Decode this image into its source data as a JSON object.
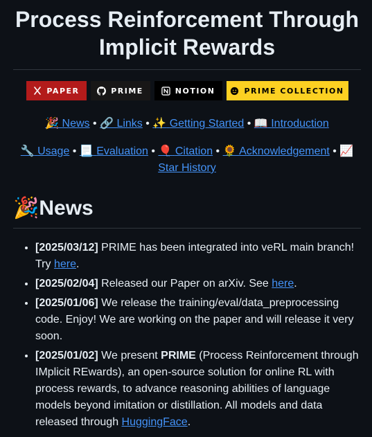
{
  "title": "Process Reinforcement Through Implicit Rewards",
  "badges": {
    "paper": {
      "label": "PAPER",
      "icon": "arxiv-icon"
    },
    "prime": {
      "label": "PRIME",
      "icon": "github-icon"
    },
    "notion": {
      "label": "NOTION",
      "icon": "notion-icon"
    },
    "collection": {
      "label": "PRIME COLLECTION",
      "icon": "huggingface-icon"
    }
  },
  "nav": {
    "news": {
      "emoji": "🎉",
      "label": "News"
    },
    "links": {
      "emoji": "🔗",
      "label": "Links"
    },
    "getting_started": {
      "emoji": "✨",
      "label": "Getting Started"
    },
    "introduction": {
      "emoji": "📖",
      "label": "Introduction"
    },
    "usage": {
      "emoji": "🔧",
      "label": "Usage"
    },
    "evaluation": {
      "emoji": "📃",
      "label": "Evaluation"
    },
    "citation": {
      "emoji": "🎈",
      "label": "Citation"
    },
    "acknowledgement": {
      "emoji": "🌻",
      "label": "Acknowledgement"
    },
    "star_history": {
      "emoji": "📈",
      "label": "Star History"
    },
    "separator": "•"
  },
  "news_section": {
    "emoji": "🎉",
    "heading": "News",
    "items": [
      {
        "date": "[2025/03/12]",
        "text_before": " PRIME has been integrated into veRL main branch! Try ",
        "link": "here",
        "text_after": "."
      },
      {
        "date": "[2025/02/04]",
        "text_before": " Released our Paper on arXiv. See ",
        "link": "here",
        "text_after": "."
      },
      {
        "date": "[2025/01/06]",
        "text": " We release the training/eval/data_preprocessing code. Enjoy! We are working on the paper and will release it very soon."
      },
      {
        "date": "[2025/01/02]",
        "text_before": " We present ",
        "bold": "PRIME",
        "text_middle": " (Process Reinforcement through IMplicit REwards), an open-source solution for online RL with process rewards, to advance reasoning abilities of language models beyond imitation or distillation. All models and data released through ",
        "link": "HuggingFace",
        "text_after": "."
      }
    ]
  }
}
